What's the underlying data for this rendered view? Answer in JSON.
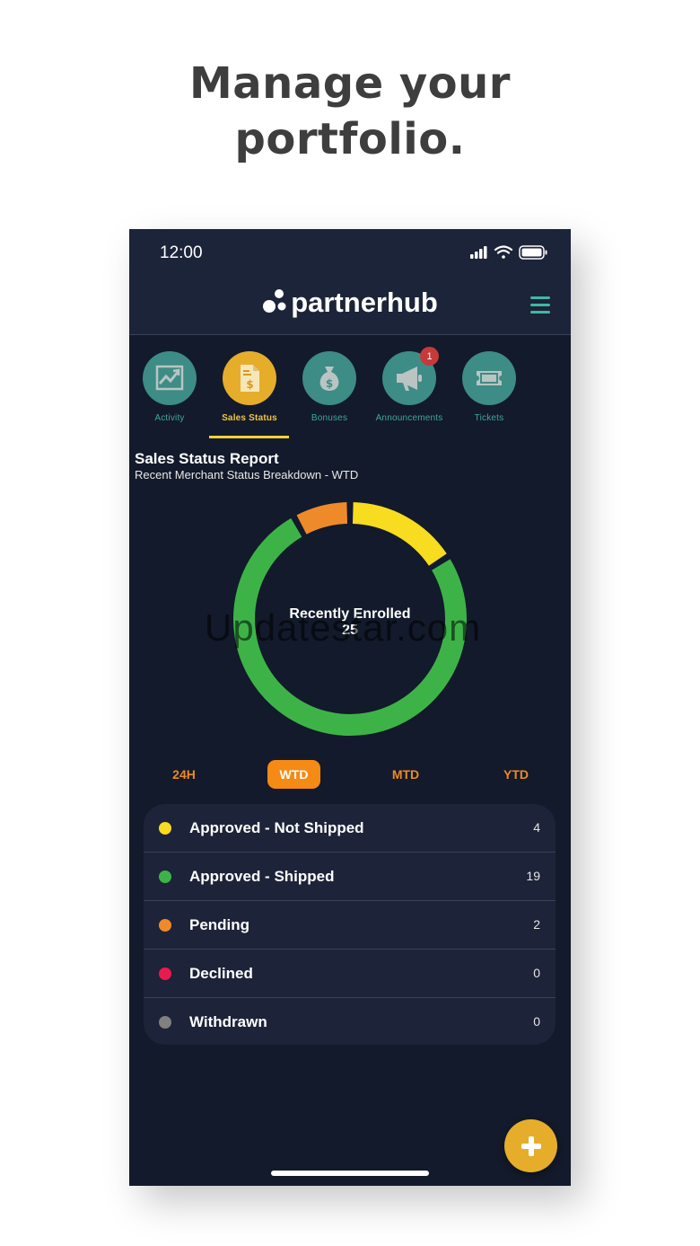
{
  "headline": {
    "line1": "Manage your",
    "line2": "portfolio."
  },
  "status_bar": {
    "time": "12:00"
  },
  "app": {
    "logo_text": "partnerhub"
  },
  "tabs": [
    {
      "label": "Activity",
      "icon": "chart-icon"
    },
    {
      "label": "Sales Status",
      "icon": "invoice-icon",
      "active": true
    },
    {
      "label": "Bonuses",
      "icon": "money-bag-icon"
    },
    {
      "label": "Announcements",
      "icon": "megaphone-icon",
      "badge": "1"
    },
    {
      "label": "Tickets",
      "icon": "ticket-icon"
    }
  ],
  "report": {
    "title": "Sales Status Report",
    "subtitle": "Recent Merchant Status Breakdown - WTD",
    "center_label": "Recently Enrolled",
    "center_value": "25"
  },
  "watermark": "Updatestar.com",
  "ranges": {
    "r24h": "24H",
    "wtd": "WTD",
    "mtd": "MTD",
    "ytd": "YTD",
    "selected": "WTD"
  },
  "chart_data": {
    "type": "pie",
    "categories": [
      "Approved - Not Shipped",
      "Approved - Shipped",
      "Pending",
      "Declined",
      "Withdrawn"
    ],
    "values": [
      4,
      19,
      2,
      0,
      0
    ],
    "colors": [
      "#f7dc1f",
      "#3db347",
      "#ef8a2b",
      "#e81a4f",
      "#808080"
    ]
  },
  "legend": [
    {
      "label": "Approved - Not Shipped",
      "count": "4",
      "color": "#f7dc1f"
    },
    {
      "label": "Approved - Shipped",
      "count": "19",
      "color": "#3db347"
    },
    {
      "label": "Pending",
      "count": "2",
      "color": "#ef8a2b"
    },
    {
      "label": "Declined",
      "count": "0",
      "color": "#e81a4f"
    },
    {
      "label": "Withdrawn",
      "count": "0",
      "color": "#808080"
    }
  ],
  "theme": {
    "accent": "#e6ad2b",
    "teal": "#3d8c86",
    "background": "#121a2b"
  }
}
